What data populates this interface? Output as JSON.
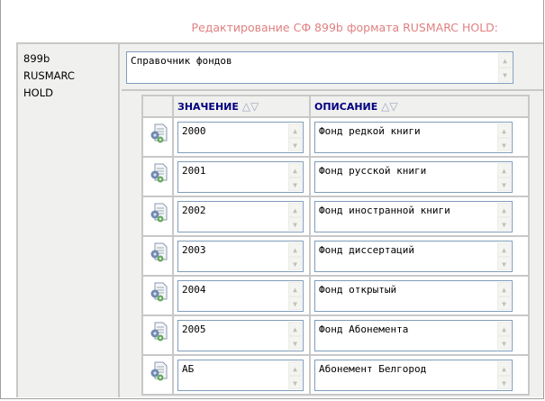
{
  "title": "Редактирование СФ 899b формата RUSMARC HOLD:",
  "field_label": [
    "899b",
    "RUSMARC",
    "HOLD"
  ],
  "field_value": "Справочник фондов",
  "columns": {
    "value": "ЗНАЧЕНИЕ",
    "description": "ОПИСАНИЕ"
  },
  "rows": [
    {
      "value": "2000",
      "description": "Фонд редкой книги"
    },
    {
      "value": "2001",
      "description": "Фонд русской книги"
    },
    {
      "value": "2002",
      "description": "Фонд иностранной книги"
    },
    {
      "value": "2003",
      "description": "Фонд диссертаций"
    },
    {
      "value": "2004",
      "description": "Фонд открытый"
    },
    {
      "value": "2005",
      "description": "Фонд Абонемента"
    },
    {
      "value": "АБ",
      "description": "Абонемент Белгород"
    }
  ]
}
